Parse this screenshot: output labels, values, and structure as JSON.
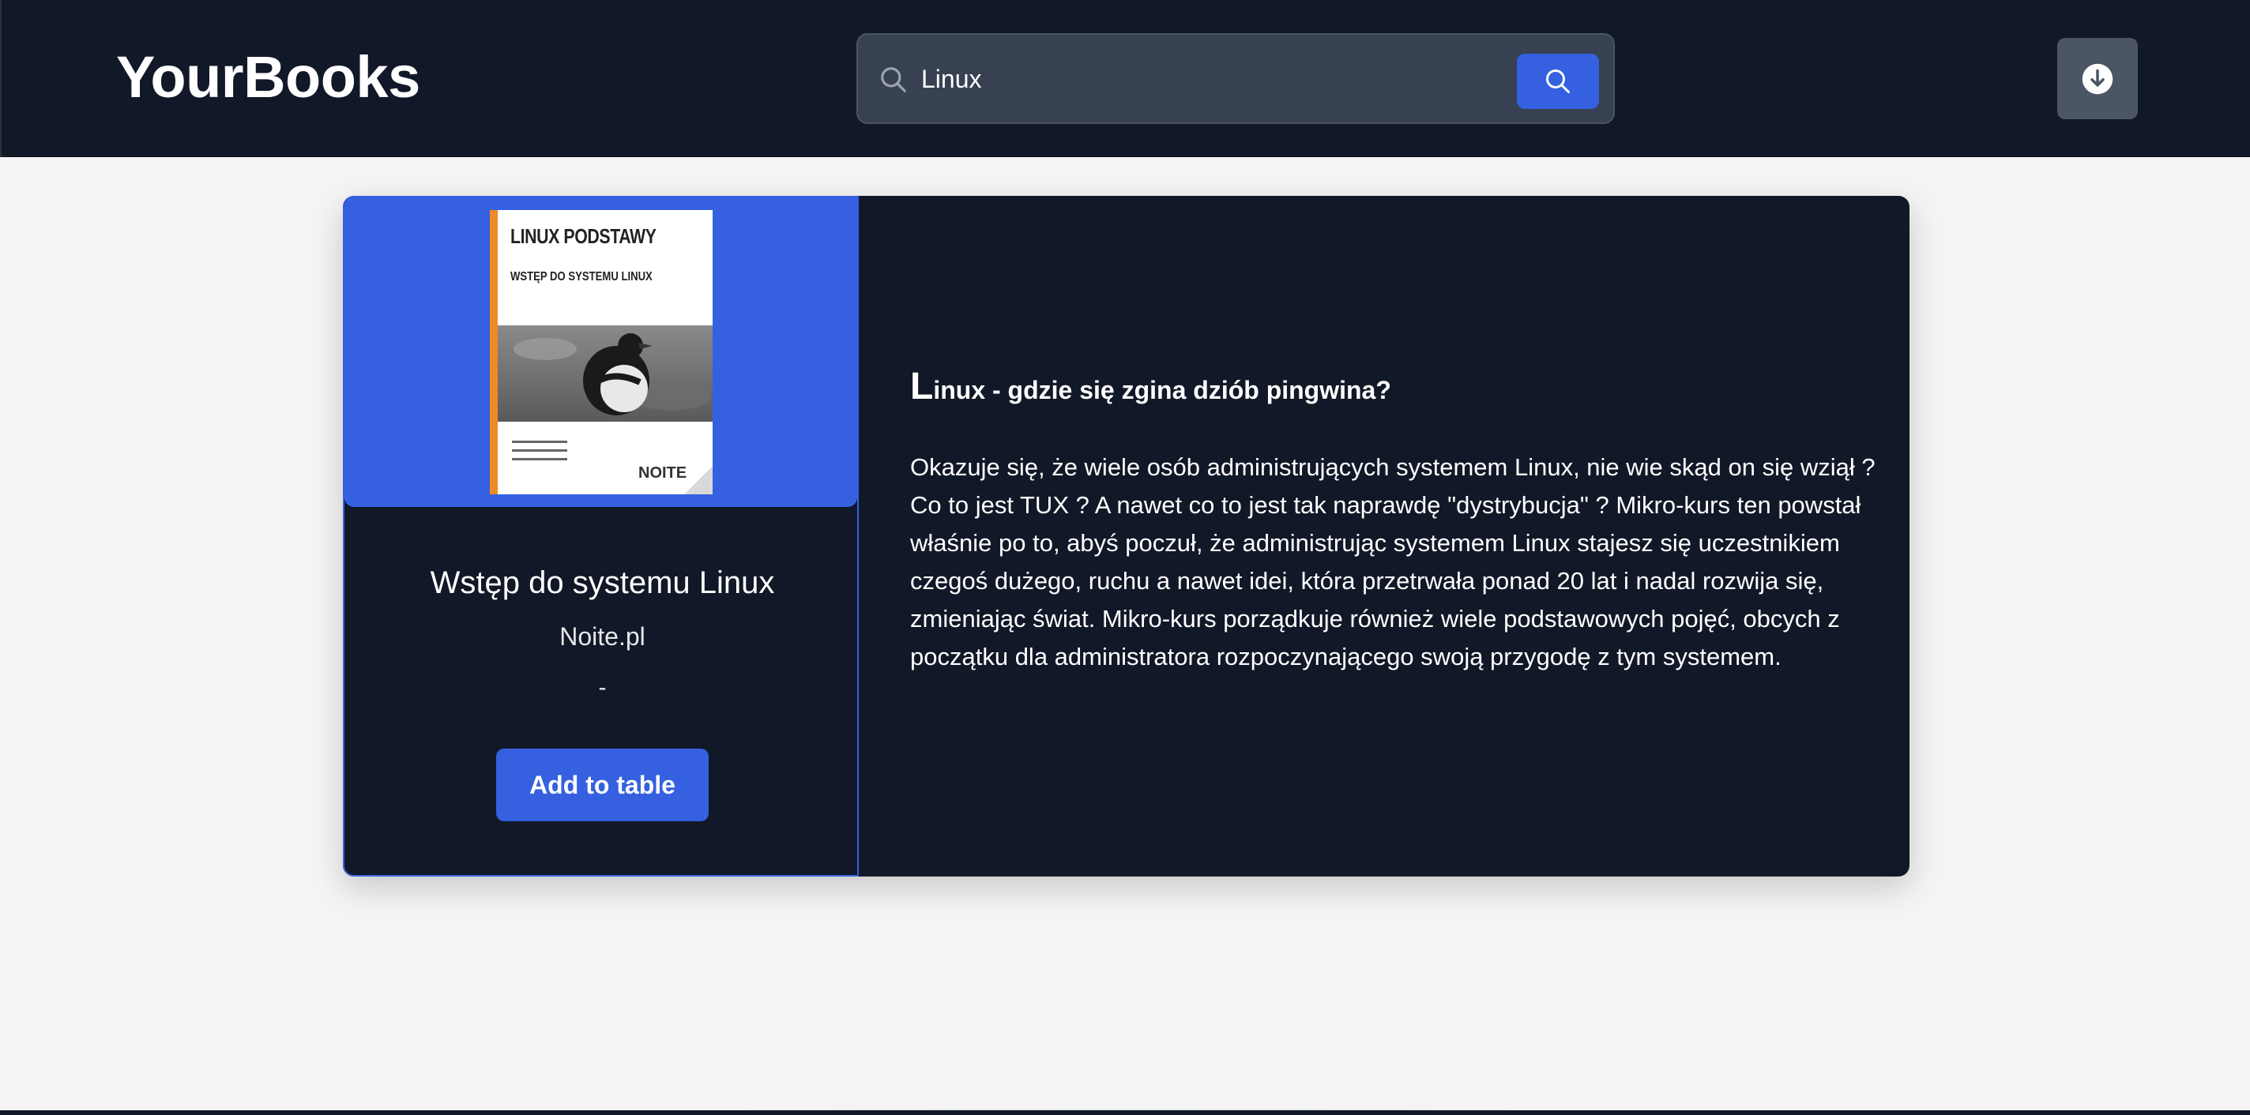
{
  "header": {
    "brand": "YourBooks",
    "search": {
      "value": "Linux",
      "placeholder": ""
    },
    "search_button_icon": "search-icon",
    "download_button_icon": "download-icon"
  },
  "book": {
    "cover": {
      "title": "LINUX PODSTAWY",
      "subtitle": "WSTĘP DO SYSTEMU LINUX",
      "logo": "NOITE"
    },
    "title": "Wstęp do systemu Linux",
    "author": "Noite.pl",
    "extra": "-",
    "add_button_label": "Add to table",
    "description_heading_first": "L",
    "description_heading_rest": "inux - gdzie się zgina dziób pingwina?",
    "description": "Okazuje się, że wiele osób administrujących systemem Linux, nie wie skąd on się wziął ? Co to jest TUX ? A nawet co to jest tak naprawdę \"dystrybucja\" ? Mikro-kurs ten powstał właśnie po to, abyś poczuł, że administrując systemem Linux stajesz się uczestnikiem czegoś dużego, ruchu a nawet idei, która przetrwała ponad 20 lat i nadal rozwija się, zmieniając świat. Mikro-kurs porządkuje również wiele podstawowych pojęć, obcych z początku dla administratora rozpoczynającego swoją przygodę z tym systemem."
  },
  "colors": {
    "header_bg": "#111827",
    "accent": "#3560e0",
    "card_bg": "#111827",
    "page_bg": "#f4f4f4"
  }
}
